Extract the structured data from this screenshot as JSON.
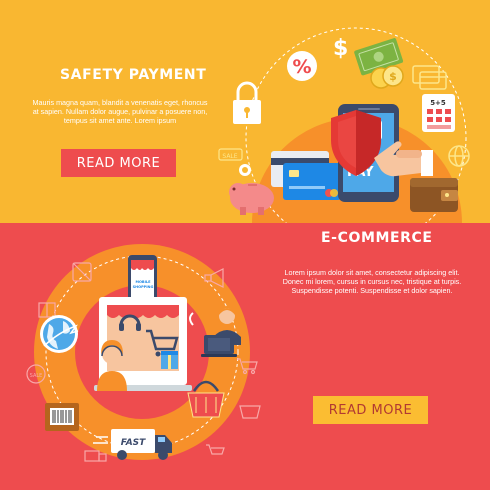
{
  "top_banner": {
    "title": "SAFETY PAYMENT",
    "body_lines": [
      "Mauris magna quam, blandit a venenatis eget, rhoncus",
      "at sapien. Nullam dolor augue, pulvinar a posuere non,",
      "tempus sit amet ante. Lorem ipsum"
    ],
    "button_label": "READ MORE",
    "icon_texts": {
      "percent": "%",
      "dollar": "$",
      "coin": "$",
      "calculator": "5+5",
      "sale": "SALE",
      "phone": "PAY"
    }
  },
  "bottom_banner": {
    "title": "E-COMMERCE",
    "body_lines": [
      "Lorem ipsum dolor sit amet, consectetur adipiscing elit.",
      "Donec mi lorem, cursus in cursus nec, tristique at turpis.",
      "Suspendisse potenti. Suspendisse et dolor sapien."
    ],
    "button_label": "READ MORE",
    "icon_texts": {
      "tablet": "MOBILE SHOPPING",
      "truck": "FAST",
      "sale": "SALE"
    }
  },
  "colors": {
    "yellow": "#f9b731",
    "red": "#ee4c4e",
    "orange": "#f7902a",
    "dark_blue": "#3b4a6b"
  }
}
